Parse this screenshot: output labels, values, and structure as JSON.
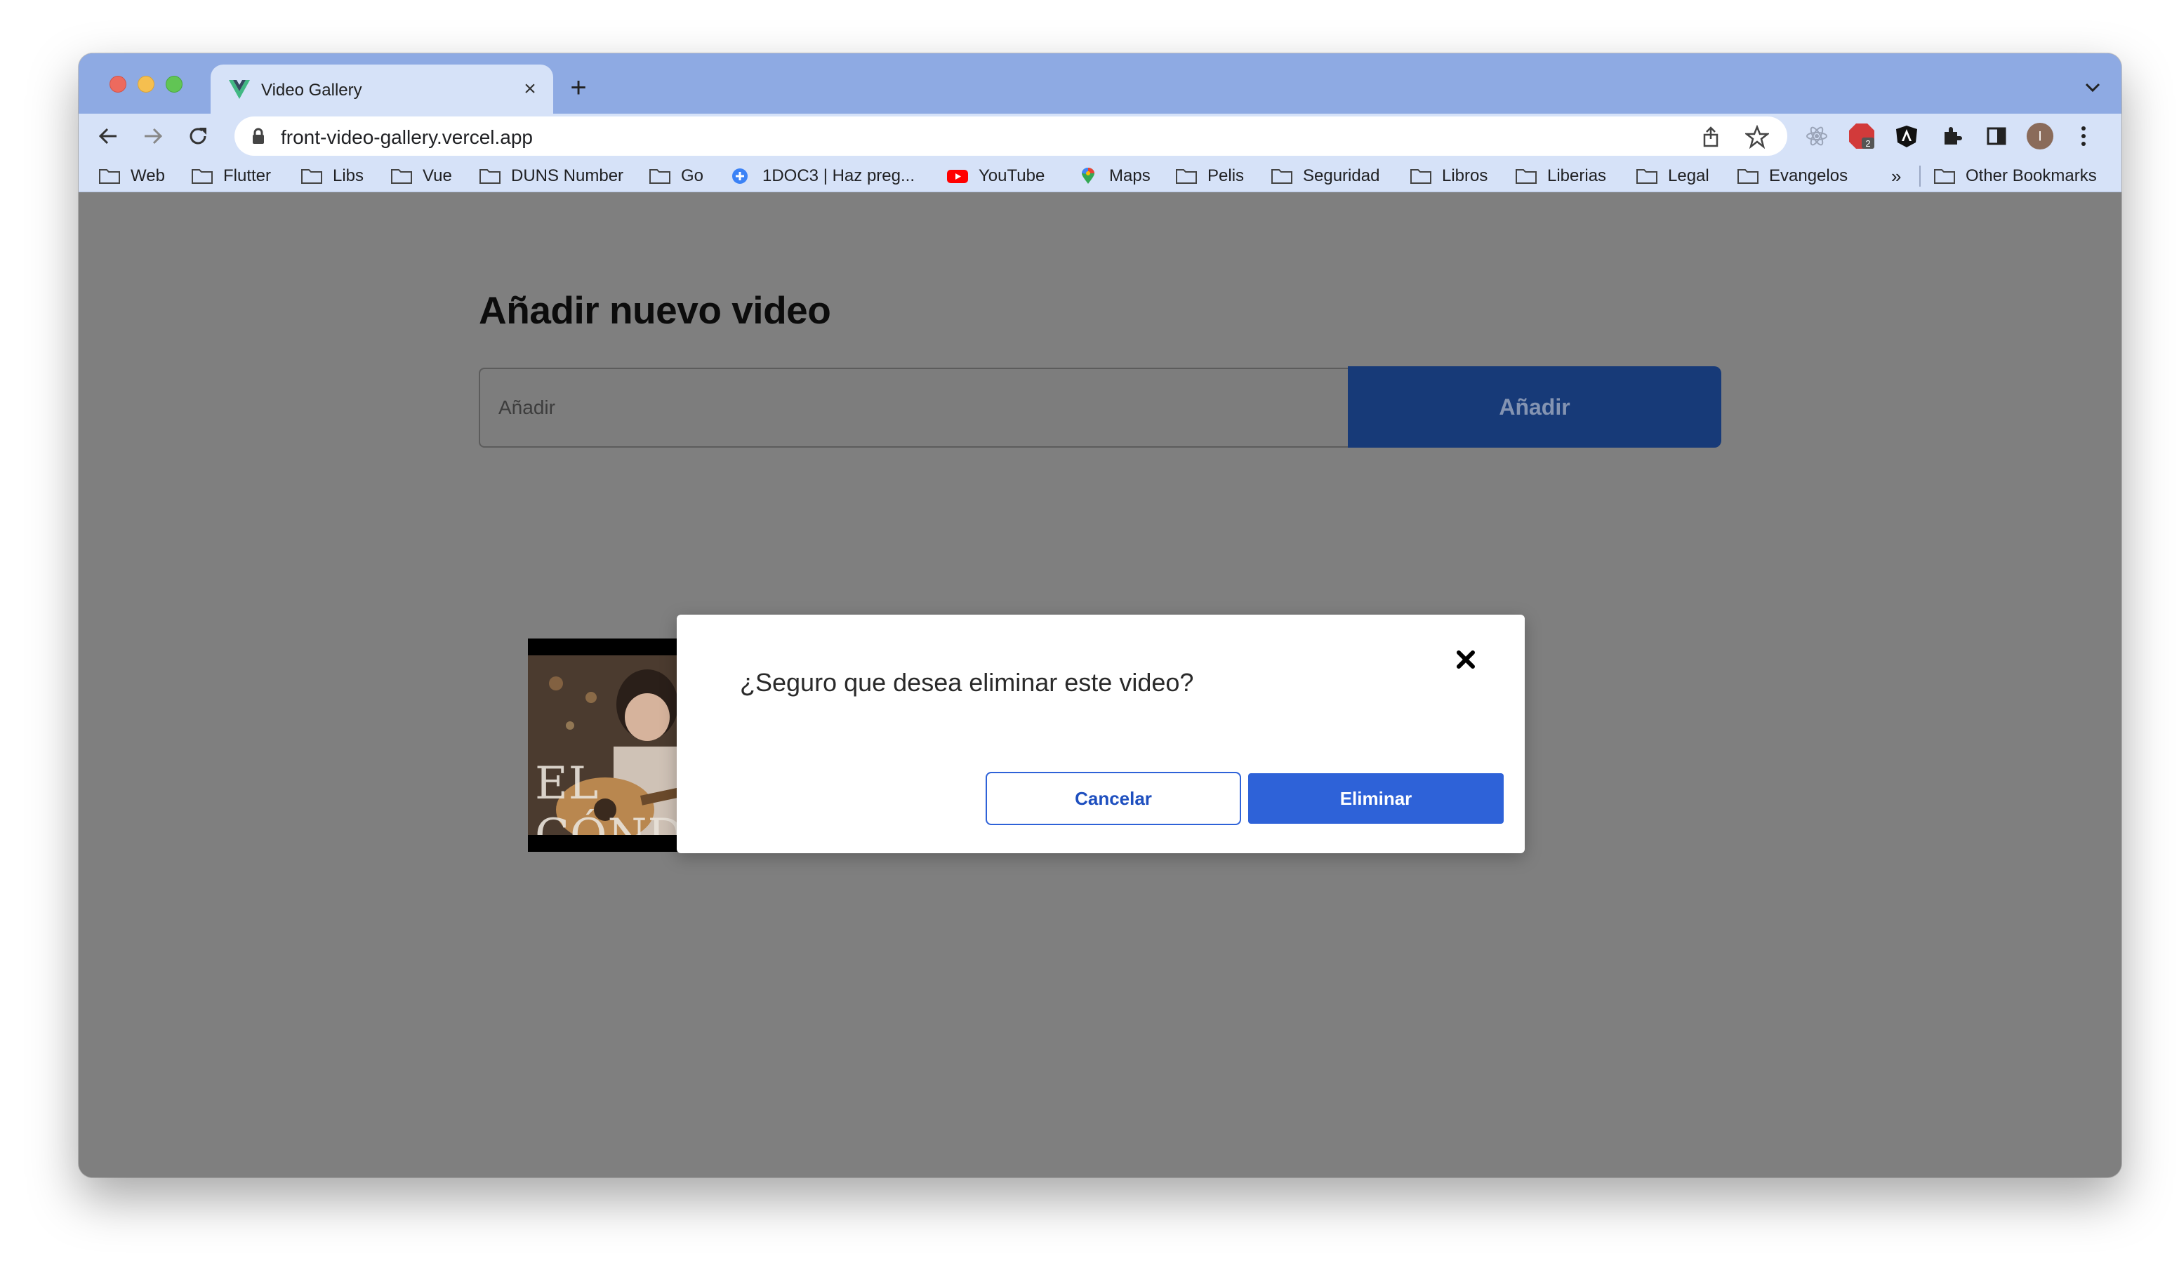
{
  "browser": {
    "tab": {
      "title": "Video Gallery",
      "close": "×"
    },
    "new_tab": "+",
    "url": "front-video-gallery.vercel.app",
    "extension_badge": "2",
    "profile_initial": "I",
    "bookmarks": [
      {
        "label": "Web",
        "icon": "folder-icon"
      },
      {
        "label": "Flutter",
        "icon": "folder-icon"
      },
      {
        "label": "Libs",
        "icon": "folder-icon"
      },
      {
        "label": "Vue",
        "icon": "folder-icon"
      },
      {
        "label": "DUNS Number",
        "icon": "folder-icon"
      },
      {
        "label": "Go",
        "icon": "folder-icon"
      },
      {
        "label": "1DOC3 | Haz preg...",
        "icon": "plus-circle-icon"
      },
      {
        "label": "YouTube",
        "icon": "youtube-icon"
      },
      {
        "label": "Maps",
        "icon": "maps-pin-icon"
      },
      {
        "label": "Pelis",
        "icon": "folder-icon"
      },
      {
        "label": "Seguridad",
        "icon": "folder-icon"
      },
      {
        "label": "Libros",
        "icon": "folder-icon"
      },
      {
        "label": "Liberias",
        "icon": "folder-icon"
      },
      {
        "label": "Legal",
        "icon": "folder-icon"
      },
      {
        "label": "Evangelos",
        "icon": "folder-icon"
      }
    ],
    "bookmarks_overflow": "»",
    "other_bookmarks": "Other Bookmarks"
  },
  "page": {
    "heading": "Añadir nuevo video",
    "input_placeholder": "Añadir",
    "add_button": "Añadir",
    "thumbnail_text": "EL CÓND"
  },
  "modal": {
    "message": "¿Seguro que desea eliminar este video?",
    "cancel": "Cancelar",
    "delete": "Eliminar"
  },
  "colors": {
    "titlebar": "#8eaae3",
    "toolbar": "#d6e2f8",
    "overlay": "#7f7f7f",
    "add_button": "#173a78",
    "primary": "#2e62d8"
  }
}
